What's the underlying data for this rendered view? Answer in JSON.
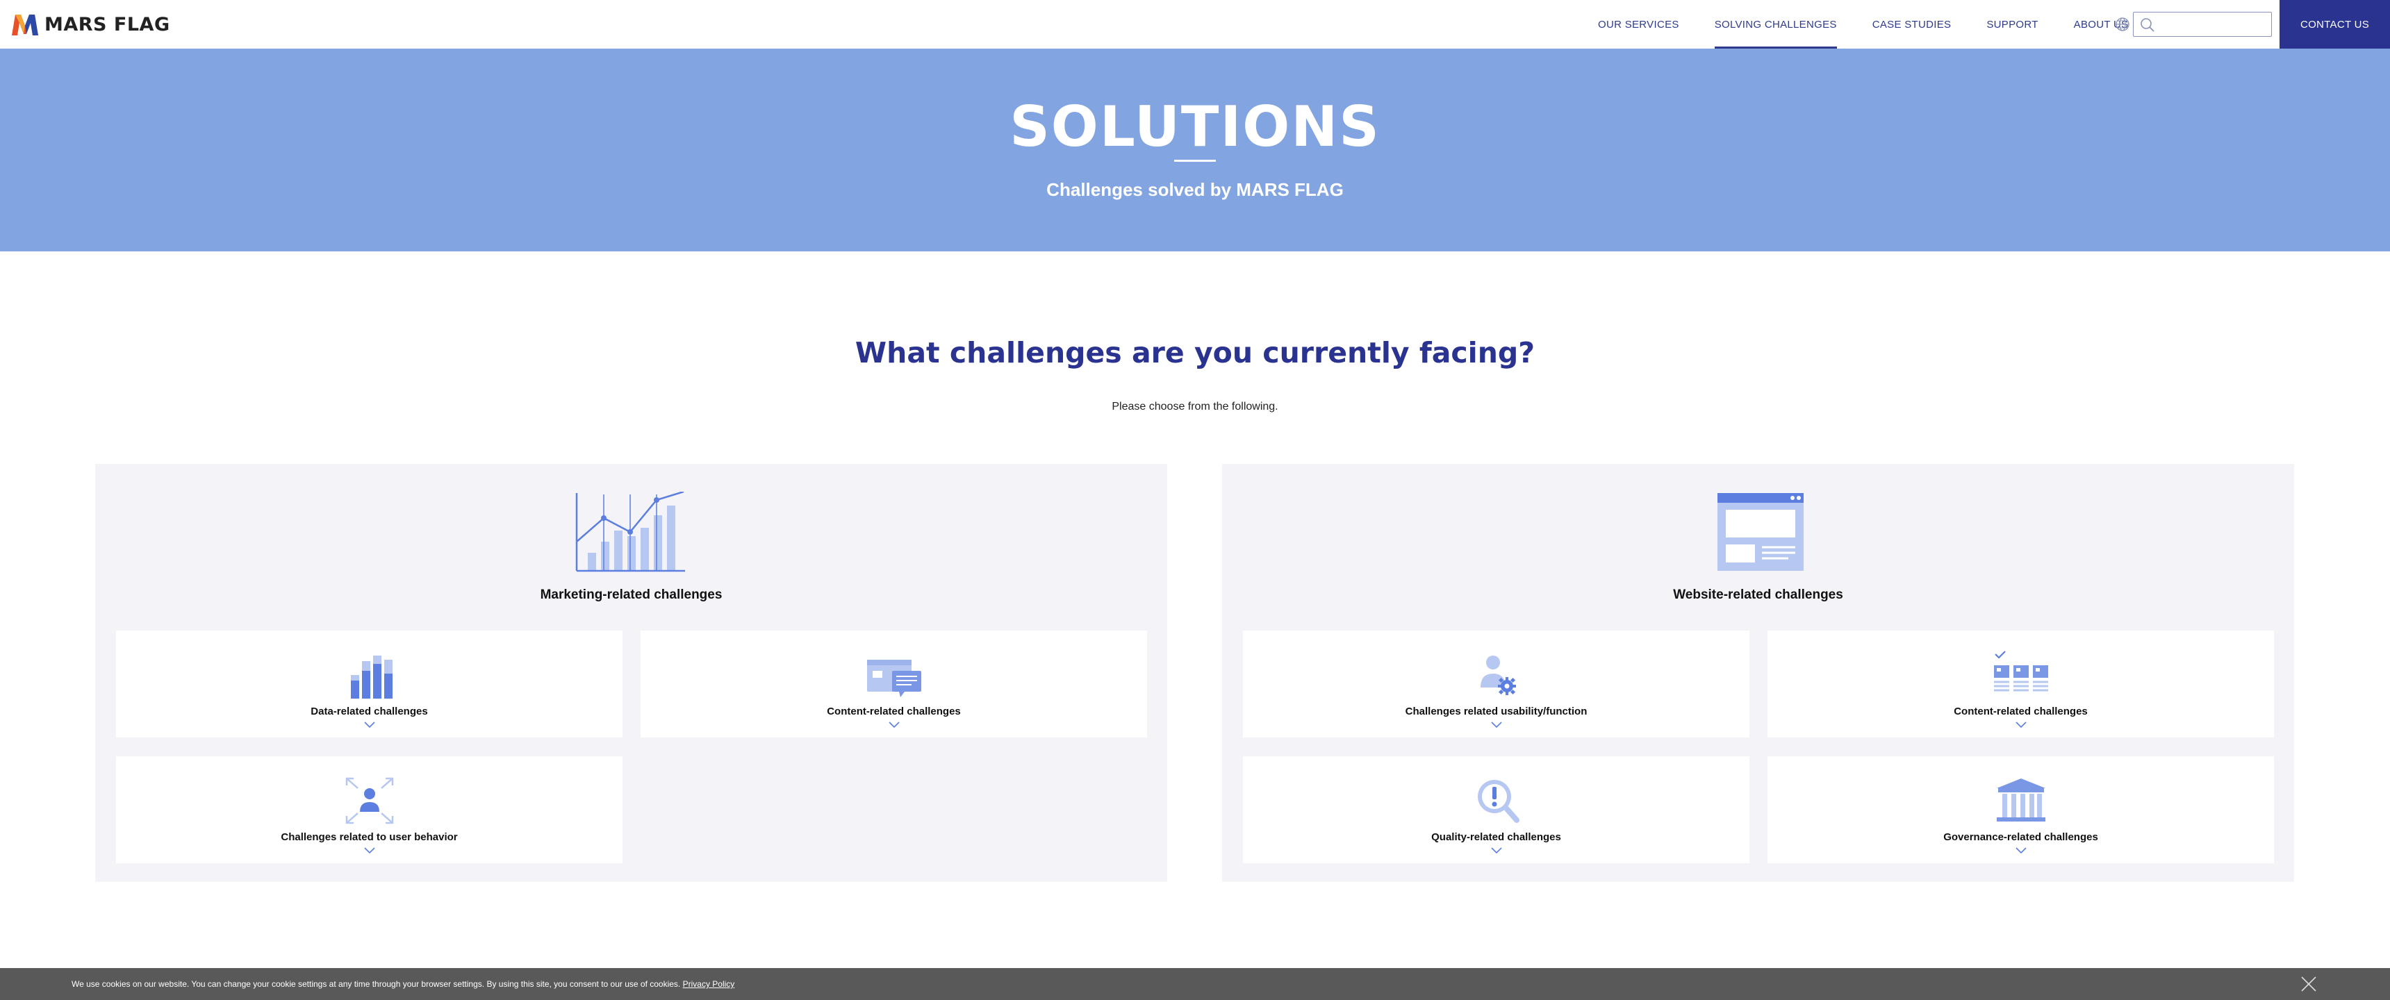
{
  "header": {
    "logo_text": "MARS FLAG",
    "nav": [
      {
        "label": "OUR SERVICES",
        "active": false
      },
      {
        "label": "SOLVING CHALLENGES",
        "active": true
      },
      {
        "label": "CASE STUDIES",
        "active": false
      },
      {
        "label": "SUPPORT",
        "active": false
      },
      {
        "label": "ABOUT US",
        "active": false
      }
    ],
    "search_placeholder": "",
    "contact_label": "CONTACT US",
    "icons": {
      "globe": "globe-icon",
      "search": "search-icon"
    }
  },
  "hero": {
    "title": "SOLUTIONS",
    "subtitle": "Challenges solved by MARS FLAG",
    "background": "#82a4e0"
  },
  "main": {
    "heading": "What challenges are you currently facing?",
    "subheading": "Please choose from the following.",
    "panels": [
      {
        "title": "Marketing-related challenges",
        "icon": "chart-growth-icon",
        "cards": [
          {
            "label": "Data-related challenges",
            "icon": "bar-chart-icon"
          },
          {
            "label": "Content-related challenges",
            "icon": "content-cards-icon"
          },
          {
            "label": "Challenges related to user behavior",
            "icon": "user-expand-icon"
          }
        ]
      },
      {
        "title": "Website-related challenges",
        "icon": "browser-window-icon",
        "cards": [
          {
            "label": "Challenges related usability/function",
            "icon": "user-gear-icon"
          },
          {
            "label": "Content-related challenges",
            "icon": "checked-cards-icon"
          },
          {
            "label": "Quality-related challenges",
            "icon": "magnifier-alert-icon"
          },
          {
            "label": "Governance-related challenges",
            "icon": "institution-icon"
          }
        ]
      }
    ]
  },
  "cookie": {
    "text": "We use cookies on our website. You can change your cookie settings at any time through your browser settings. By using this site, you consent to our use of cookies.",
    "link": "Privacy Policy"
  },
  "colors": {
    "accent": "#2b3390",
    "icon": "#5b7ee0",
    "icon_light": "#b6c8f2",
    "panel_bg": "#f4f4f8",
    "cookie_bg": "#595959"
  }
}
